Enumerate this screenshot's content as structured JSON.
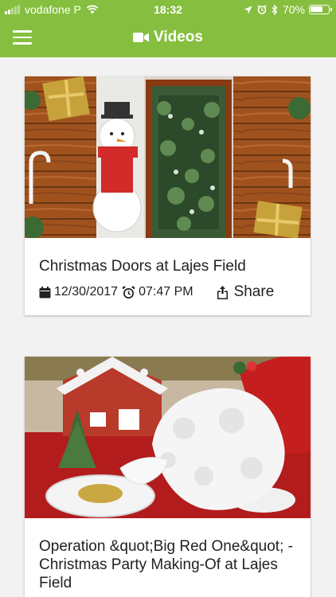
{
  "status_bar": {
    "carrier": "vodafone P",
    "time": "18:32",
    "battery": "70%",
    "battery_level": 0.7
  },
  "header": {
    "title": "Videos",
    "menu_icon": "hamburger-menu-icon",
    "title_icon": "video-camera-icon"
  },
  "colors": {
    "header_bg": "#86bf3f",
    "page_bg": "#f2f2f2",
    "card_bg": "#ffffff"
  },
  "videos": [
    {
      "title": "Christmas Doors at Lajes Field",
      "date": "12/30/2017",
      "time": "07:47 PM",
      "share_label": "Share"
    },
    {
      "title": "Operation &quot;Big Red One&quot; - Christmas Party Making-Of at Lajes Field"
    }
  ]
}
